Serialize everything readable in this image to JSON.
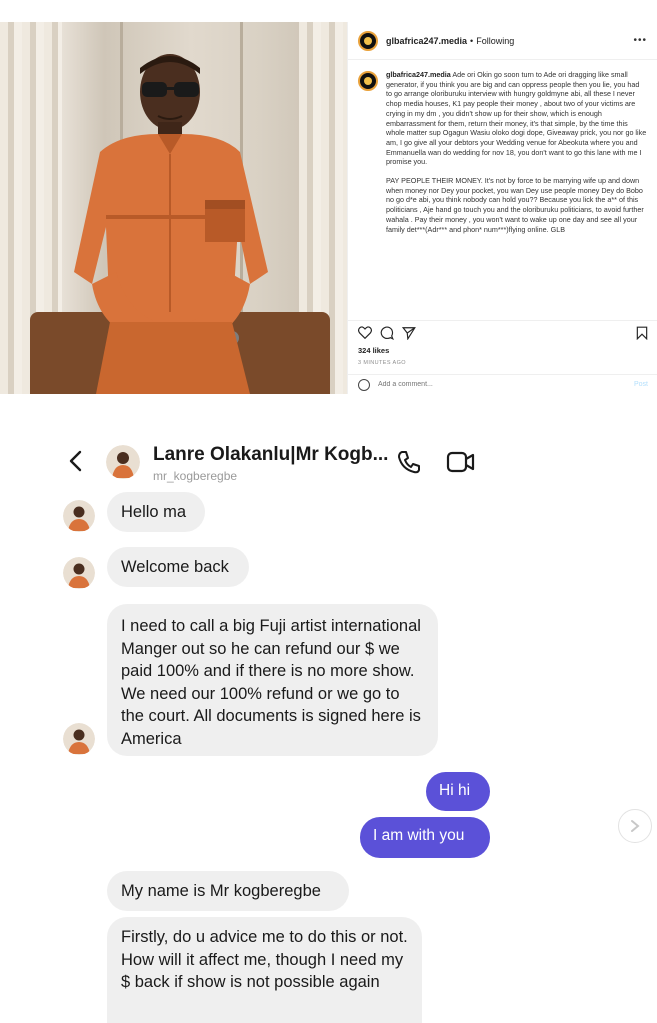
{
  "post": {
    "username": "glbafrica247.media",
    "separator": "•",
    "follow_status": "Following",
    "more_glyph": "•••",
    "caption_user": "glbafrica247.media",
    "caption_p1": "Ade ori Okin go soon turn to Ade ori dragging like small generator, if you think you are big and can oppress people then you lie, you had to go arrange oloriburuku interview with hungry goldmyne abi, all these I never chop media houses, K1 pay people their money , about two of your victims are crying in my dm , you didn't show up for their show, which is enough embarrassment for them, return their money, it's that simple, by the time this whole matter sup Ogagun Wasiu oloko dogi dope, Giveaway prick, you nor go like am, I go give all your debtors your Wedding venue for Abeokuta where you and Emmanuella wan do wedding for nov 18, you don't want to go this lane with me I promise you.",
    "caption_p2": "PAY PEOPLE THEIR MONEY. It's not by force to be marrying wife up and down when money nor Dey your pocket, you wan Dey use people money Dey do Bobo no go d*e abi, you think nobody can hold you?? Because you lick the a** of this politicians , Aje hand go touch you and the oloriburuku politicians, to avoid further wahala . Pay their money , you won't want to wake up one day and see all your family det***(Adr*** and phon* num***)flying online. GLB",
    "likes": "324 likes",
    "time": "3 MINUTES AGO",
    "comment_placeholder": "Add a comment...",
    "post_button": "Post",
    "photo_colors": {
      "outfit": "#d9733b",
      "outfit_shade": "#b85a28",
      "skin": "#4a2e1f",
      "curtain": "#ece5da"
    }
  },
  "dm": {
    "contact_name": "Lanre Olakanlu|Mr Kogb...",
    "contact_handle": "mr_kogberegbe",
    "icons": [
      "back-icon",
      "call-icon",
      "video-icon",
      "next-icon"
    ],
    "messages": [
      {
        "dir": "in",
        "text": "Hello ma"
      },
      {
        "dir": "in",
        "text": "Welcome back"
      },
      {
        "dir": "in",
        "text": "I need to call a big Fuji artist international Manger out so he can refund our $ we paid 100% and if there is no more show. We need our 100% refund or we go to the court. All documents is signed here is America"
      },
      {
        "dir": "out",
        "text": "Hi hi"
      },
      {
        "dir": "out",
        "text": "I am with you"
      },
      {
        "dir": "in",
        "text": "My name is Mr kogberegbe"
      },
      {
        "dir": "in",
        "text": "Firstly,  do u advice me to do this or not. How will it affect me, though I need my $ back if show is not possible again"
      }
    ],
    "colors": {
      "incoming_bubble": "#efefef",
      "outgoing_bubble": "#5b51d8"
    }
  }
}
